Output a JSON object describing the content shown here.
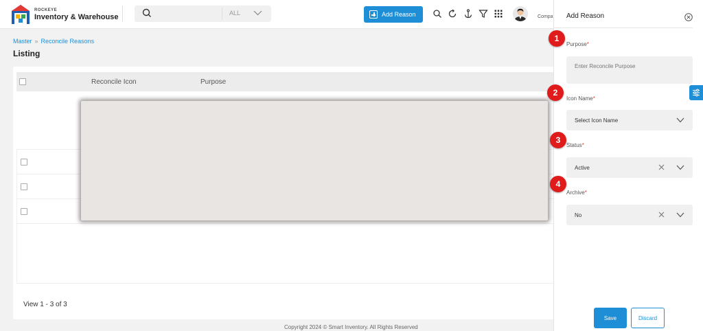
{
  "header": {
    "brand_small": "ROCKEYE",
    "brand_main": "Inventory & Warehouse",
    "search_scope": "ALL",
    "add_button_label": "Add Reason",
    "company_label": "Compa"
  },
  "breadcrumb": {
    "root": "Master",
    "current": "Reconcile Reasons"
  },
  "page_title": "Listing",
  "table": {
    "columns": [
      "Reconcile Icon",
      "Purpose"
    ],
    "row_count": 3,
    "view_count": "View 1 - 3 of 3"
  },
  "footer": {
    "copyright": "Copyright 2024 © Smart Inventory. All Rights Reserved"
  },
  "panel": {
    "title": "Add Reason",
    "fields": {
      "purpose": {
        "label": "Purpose",
        "placeholder": "Enter Reconcile Purpose"
      },
      "icon_name": {
        "label": "Icon Name",
        "value": "Select Icon Name"
      },
      "status": {
        "label": "Status",
        "value": "Active"
      },
      "archive": {
        "label": "Archive",
        "value": "No"
      }
    },
    "required_mark": "*",
    "save_label": "Save",
    "discard_label": "Discard"
  },
  "steps": [
    "1",
    "2",
    "3",
    "4"
  ],
  "colors": {
    "accent": "#1e8fd6",
    "marker": "#e01b1b",
    "required": "#e53935"
  }
}
